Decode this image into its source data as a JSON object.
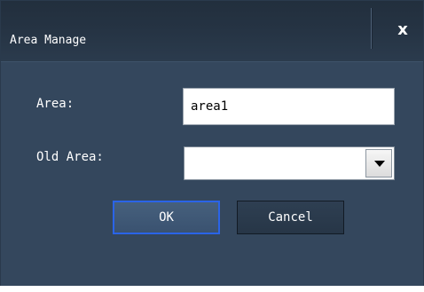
{
  "dialog": {
    "title": "Area Manage",
    "close_icon": "close-icon",
    "close_glyph": "x"
  },
  "form": {
    "area_label": "Area:",
    "area_value": "area1",
    "old_area_label": "Old Area:",
    "old_area_value": "",
    "dropdown_icon": "chevron-down-icon"
  },
  "buttons": {
    "ok_label": "OK",
    "cancel_label": "Cancel"
  },
  "colors": {
    "dialog_bg": "#34475d",
    "titlebar_bg": "#253343",
    "focus_border": "#2a64e8",
    "text": "#ffffff"
  }
}
